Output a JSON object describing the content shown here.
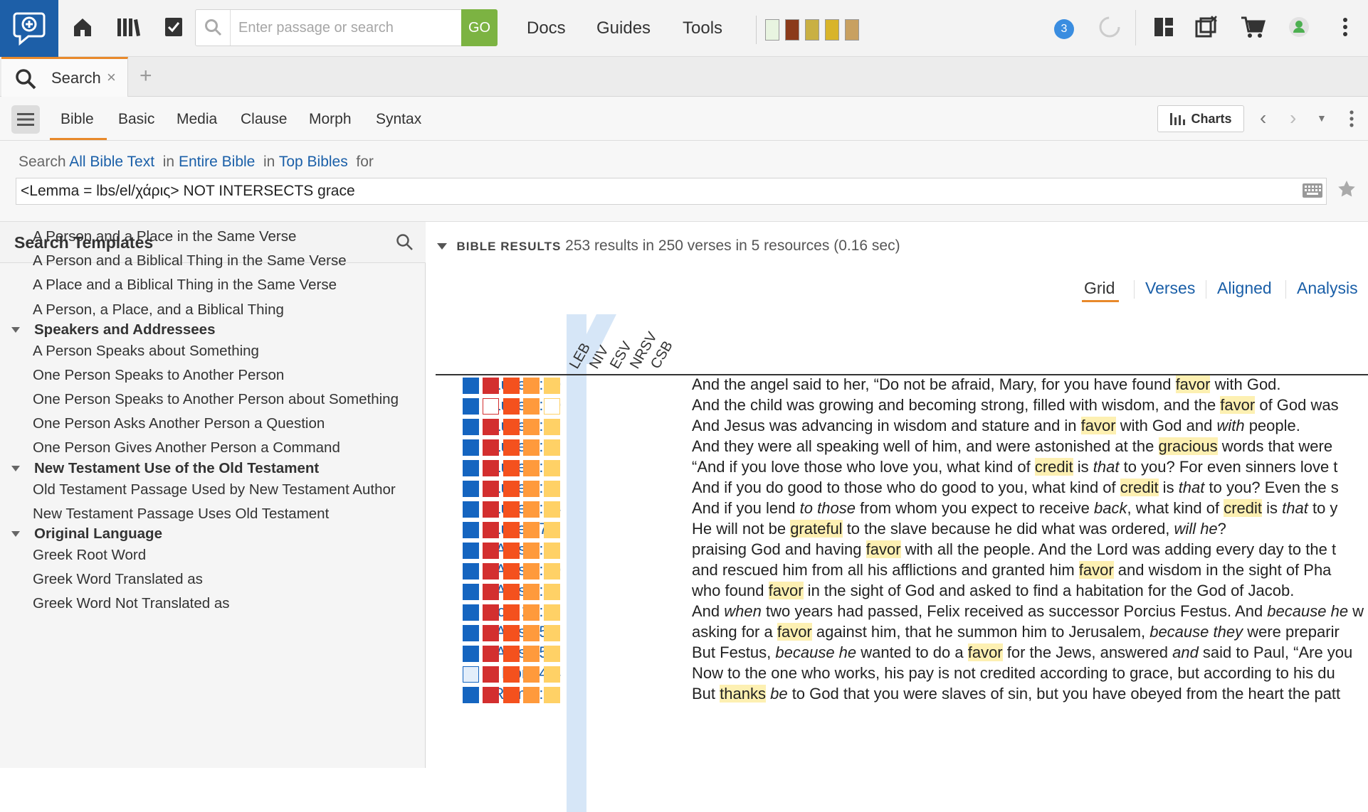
{
  "topbar": {
    "search_placeholder": "Enter passage or search",
    "go_label": "GO",
    "menus": [
      "Docs",
      "Guides",
      "Tools"
    ],
    "notification_count": "3"
  },
  "tabs": {
    "active": "Search",
    "close": "×",
    "add": "+"
  },
  "subtabs": [
    "Bible",
    "Basic",
    "Media",
    "Clause",
    "Morph",
    "Syntax"
  ],
  "charts_label": "Charts",
  "scope": {
    "prefix": "Search",
    "what": "All Bible Text",
    "in1": "in",
    "range": "Entire Bible",
    "in2": "in",
    "collection": "Top Bibles",
    "suffix": "for"
  },
  "query": "<Lemma = lbs/el/χάρις> NOT INTERSECTS grace",
  "left_panel": {
    "title": "Search Templates",
    "items": [
      {
        "type": "item",
        "text": "A Person and a Place in the Same Verse"
      },
      {
        "type": "item",
        "text": "A Person and a Biblical Thing in the Same Verse"
      },
      {
        "type": "item",
        "text": "A Place and a Biblical Thing in the Same Verse"
      },
      {
        "type": "item",
        "text": "A Person, a Place, and a Biblical Thing"
      },
      {
        "type": "group",
        "text": "Speakers and Addressees"
      },
      {
        "type": "item",
        "text": "A Person Speaks about Something"
      },
      {
        "type": "item",
        "text": "One Person Speaks to Another Person"
      },
      {
        "type": "item",
        "text": "One Person Speaks to Another Person about Something"
      },
      {
        "type": "item",
        "text": "One Person Asks Another Person a Question"
      },
      {
        "type": "item",
        "text": "One Person Gives Another Person a Command"
      },
      {
        "type": "group",
        "text": "New Testament Use of the Old Testament"
      },
      {
        "type": "item",
        "text": "Old Testament Passage Used by New Testament Author"
      },
      {
        "type": "item",
        "text": "New Testament Passage Uses Old Testament"
      },
      {
        "type": "group",
        "text": "Original Language"
      },
      {
        "type": "item",
        "text": "Greek Root Word"
      },
      {
        "type": "item",
        "text": "Greek Word Translated as"
      },
      {
        "type": "item",
        "text": "Greek Word Not Translated as"
      }
    ]
  },
  "results": {
    "caption": "BIBLE RESULTS",
    "summary": "253 results in 250 verses in 5 resources (0.16 sec)",
    "views": [
      "Grid",
      "Verses",
      "Aligned",
      "Analysis"
    ],
    "active_view": "Grid",
    "columns": [
      "LEB",
      "NIV",
      "ESV",
      "NRSV",
      "CSB"
    ],
    "column_colors": [
      "#1565c0",
      "#d32f2f",
      "#f4511e",
      "#ff9a3c",
      "#ffd166"
    ],
    "rows": [
      {
        "ref": "Luke 1:30",
        "hits": [
          1,
          1,
          1,
          1,
          1
        ],
        "parts": [
          [
            "And the angel said to her, “Do not be afraid, Mary, for you have found ",
            ""
          ],
          [
            "favor",
            "h"
          ],
          [
            " with God.",
            ""
          ]
        ]
      },
      {
        "ref": "Luke 2:40",
        "hits": [
          1,
          0,
          1,
          1,
          0
        ],
        "parts": [
          [
            "And the child was growing and becoming strong, filled with wisdom, and the ",
            ""
          ],
          [
            "favor",
            "h"
          ],
          [
            " of God was",
            ""
          ]
        ]
      },
      {
        "ref": "Luke 2:52",
        "hits": [
          1,
          1,
          1,
          1,
          1
        ],
        "parts": [
          [
            "And Jesus was advancing in wisdom and stature and in ",
            ""
          ],
          [
            "favor",
            "h"
          ],
          [
            " with God and ",
            ""
          ],
          [
            "with",
            "i"
          ],
          [
            " people.",
            ""
          ]
        ]
      },
      {
        "ref": "Luke 4:22",
        "hits": [
          1,
          1,
          1,
          1,
          1
        ],
        "parts": [
          [
            "And they were all speaking well of him, and were astonished at the ",
            ""
          ],
          [
            "gracious",
            "h"
          ],
          [
            " words that were",
            ""
          ]
        ]
      },
      {
        "ref": "Luke 6:32",
        "hits": [
          1,
          1,
          1,
          1,
          1
        ],
        "parts": [
          [
            "“And if you love those who love you, what kind of ",
            ""
          ],
          [
            "credit",
            "h"
          ],
          [
            " is ",
            ""
          ],
          [
            "that",
            "i"
          ],
          [
            " to you? For even sinners love t",
            ""
          ]
        ]
      },
      {
        "ref": "Luke 6:33",
        "hits": [
          1,
          1,
          1,
          1,
          1
        ],
        "parts": [
          [
            "And if you do good to those who do good to you, what kind of ",
            ""
          ],
          [
            "credit",
            "h"
          ],
          [
            " is ",
            ""
          ],
          [
            "that",
            "i"
          ],
          [
            " to you? Even the s",
            ""
          ]
        ]
      },
      {
        "ref": "Luke 6:34",
        "hits": [
          1,
          1,
          1,
          1,
          1
        ],
        "parts": [
          [
            "And if you lend ",
            ""
          ],
          [
            "to those",
            "i"
          ],
          [
            " from whom you expect to receive ",
            ""
          ],
          [
            "back",
            "i"
          ],
          [
            ", what kind of ",
            ""
          ],
          [
            "credit",
            "h"
          ],
          [
            " is ",
            ""
          ],
          [
            "that",
            "i"
          ],
          [
            " to y",
            ""
          ]
        ]
      },
      {
        "ref": "Luke 17:9",
        "hits": [
          1,
          1,
          1,
          1,
          1
        ],
        "parts": [
          [
            "He will not be ",
            ""
          ],
          [
            "grateful",
            "h"
          ],
          [
            " to the slave because he did what was ordered, ",
            ""
          ],
          [
            "will he",
            "i"
          ],
          [
            "?",
            ""
          ]
        ]
      },
      {
        "ref": "Acts 2:47",
        "hits": [
          1,
          1,
          1,
          1,
          1
        ],
        "parts": [
          [
            "praising God and having ",
            ""
          ],
          [
            "favor",
            "h"
          ],
          [
            " with all the people. And the Lord was adding every day to the t",
            ""
          ]
        ]
      },
      {
        "ref": "Acts 7:10",
        "hits": [
          1,
          1,
          1,
          1,
          1
        ],
        "parts": [
          [
            "and rescued him from all his afflictions and granted him ",
            ""
          ],
          [
            "favor",
            "h"
          ],
          [
            " and wisdom in the sight of Pha",
            ""
          ]
        ]
      },
      {
        "ref": "Acts 7:46",
        "hits": [
          1,
          1,
          1,
          1,
          1
        ],
        "parts": [
          [
            "who found ",
            ""
          ],
          [
            "favor",
            "h"
          ],
          [
            " in the sight of God and asked to find a habitation for the God of Jacob.",
            ""
          ]
        ]
      },
      {
        "ref": "Acts 24:27",
        "hits": [
          1,
          1,
          1,
          1,
          1
        ],
        "parts": [
          [
            "And ",
            ""
          ],
          [
            "when",
            "i"
          ],
          [
            " two years had passed, Felix received as successor Porcius Festus. And ",
            ""
          ],
          [
            "because he",
            "i"
          ],
          [
            " w",
            ""
          ]
        ]
      },
      {
        "ref": "Acts 25:3",
        "hits": [
          1,
          1,
          1,
          1,
          1
        ],
        "parts": [
          [
            "asking for a ",
            ""
          ],
          [
            "favor",
            "h"
          ],
          [
            " against him, that he summon him to Jerusalem, ",
            ""
          ],
          [
            "because they",
            "i"
          ],
          [
            " were preparir",
            ""
          ]
        ]
      },
      {
        "ref": "Acts 25:9",
        "hits": [
          1,
          1,
          1,
          1,
          1
        ],
        "parts": [
          [
            "But Festus, ",
            ""
          ],
          [
            "because he",
            "i"
          ],
          [
            " wanted to do a ",
            ""
          ],
          [
            "favor",
            "h"
          ],
          [
            " for the Jews, answered ",
            ""
          ],
          [
            "and",
            "i"
          ],
          [
            " said to Paul, “Are you",
            ""
          ]
        ]
      },
      {
        "ref": "Rom 4:4",
        "hits": [
          0,
          1,
          1,
          1,
          1
        ],
        "parts": [
          [
            "Now to the one who works, his pay is not credited according to grace, but according to his du",
            ""
          ]
        ]
      },
      {
        "ref": "Rom 6:17",
        "hits": [
          1,
          1,
          1,
          1,
          1
        ],
        "parts": [
          [
            "But ",
            ""
          ],
          [
            "thanks",
            "h"
          ],
          [
            " ",
            ""
          ],
          [
            "be",
            "i"
          ],
          [
            " to God that you were slaves of sin, but you have obeyed from the heart the patt",
            ""
          ]
        ]
      }
    ]
  }
}
